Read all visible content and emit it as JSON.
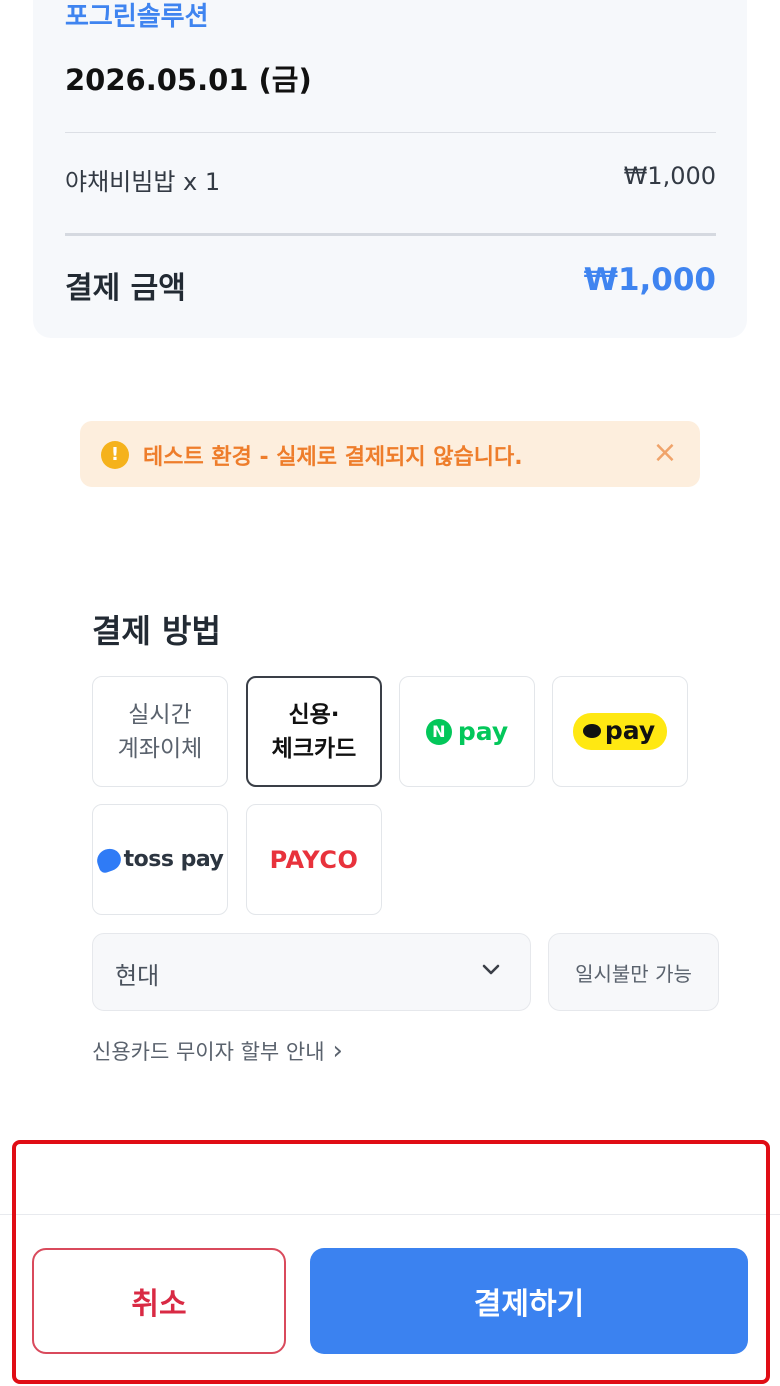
{
  "order": {
    "store_name": "포그린솔루션",
    "date": "2026.05.01 (금)",
    "item_name": "야채비빔밥 x 1",
    "item_price": "₩1,000",
    "total_label": "결제 금액",
    "total_value": "₩1,000"
  },
  "banner": {
    "icon": "!",
    "text": "테스트 환경 - 실제로 결제되지 않습니다.",
    "close": "×"
  },
  "payment": {
    "section_title": "결제 방법",
    "methods": [
      {
        "line1": "실시간",
        "line2": "계좌이체"
      },
      {
        "line1": "신용·",
        "line2": "체크카드"
      },
      {
        "logo": "N",
        "label": "pay"
      },
      {
        "label": "pay"
      },
      {
        "label": "toss pay"
      },
      {
        "label": "PAYCO"
      }
    ],
    "selected_method_index": 1,
    "card_select_value": "현대",
    "installment": "일시불만 가능",
    "installment_link": "신용카드 무이자 할부 안내",
    "installment_link_arrow": "›"
  },
  "actions": {
    "cancel": "취소",
    "pay": "결제하기"
  },
  "colors": {
    "accent": "#3b82f0",
    "cancel": "#d92a44",
    "warning_bg": "#fdeedd",
    "warning_text": "#ee7d2b",
    "naver_green": "#03c75a",
    "kakao_yellow": "#ffe812",
    "payco_red": "#e8323c",
    "highlight_red": "#e00d15"
  }
}
